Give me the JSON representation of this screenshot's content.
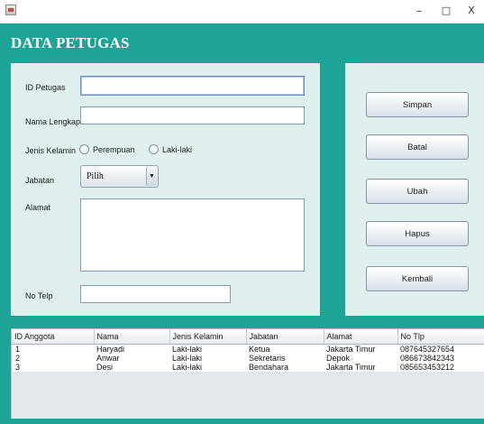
{
  "window": {
    "icon": "java-cup-icon",
    "minimize_label": "–",
    "maximize_label": "□",
    "close_label": "X"
  },
  "page": {
    "title": "DATA PETUGAS"
  },
  "form": {
    "id_label": "ID Petugas",
    "id_value": "",
    "nama_label": "Nama Lengkap",
    "nama_value": "",
    "gender_label": "Jenis Kelamin",
    "gender_options": [
      "Perempuan",
      "Laki-laki"
    ],
    "jabatan_label": "Jabatan",
    "jabatan_selected": "Pilih",
    "alamat_label": "Alamat",
    "alamat_value": "",
    "telp_label": "No Telp",
    "telp_value": ""
  },
  "actions": {
    "simpan": "Simpan",
    "batal": "Batal",
    "ubah": "Ubah",
    "hapus": "Hapus",
    "kembali": "Kembali"
  },
  "table": {
    "columns": [
      "ID Anggota",
      "Nama",
      "Jenis Kelamin",
      "Jabatan",
      "Alamat",
      "No Tlp"
    ],
    "rows": [
      [
        "1",
        "Haryadi",
        "Laki-laki",
        "Ketua",
        "Jakarta Timur",
        "087645327654"
      ],
      [
        "2",
        "Anwar",
        "Laki-laki",
        "Sekretaris",
        "Depok",
        "086673842343"
      ],
      [
        "3",
        "Desi",
        "Laki-laki",
        "Bendahara",
        "Jakarta Timur",
        "085653453212"
      ]
    ]
  },
  "colors": {
    "teal_background": "#1ea497",
    "panel_background": "#dff0ee",
    "title_text": "#ffffff"
  }
}
